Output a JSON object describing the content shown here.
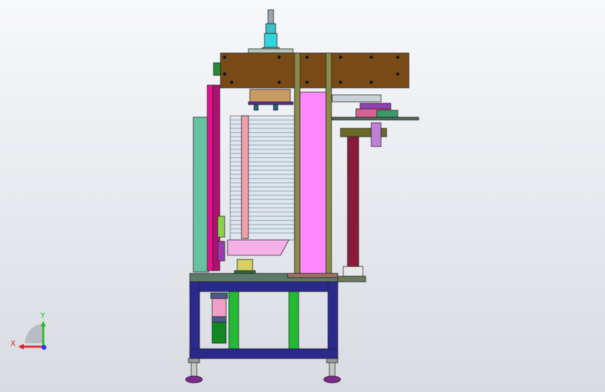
{
  "view": {
    "background_top": "#f7f8fb",
    "background_bottom": "#d8dbe2"
  },
  "triad": {
    "x_label": "X",
    "y_label": "Y",
    "x_color": "#e0242c",
    "y_color": "#2eb82e",
    "z_color": "#2340d8"
  },
  "model": {
    "plate_color": "#7a4a16",
    "frame_color": "#2a2a8c",
    "leg_color": "#22bb33",
    "panel_pink": "#ff88ff",
    "panel_teal": "#66c2a0",
    "column_maroon": "#8a1a3a",
    "stack_color": "#c8d4e0"
  }
}
